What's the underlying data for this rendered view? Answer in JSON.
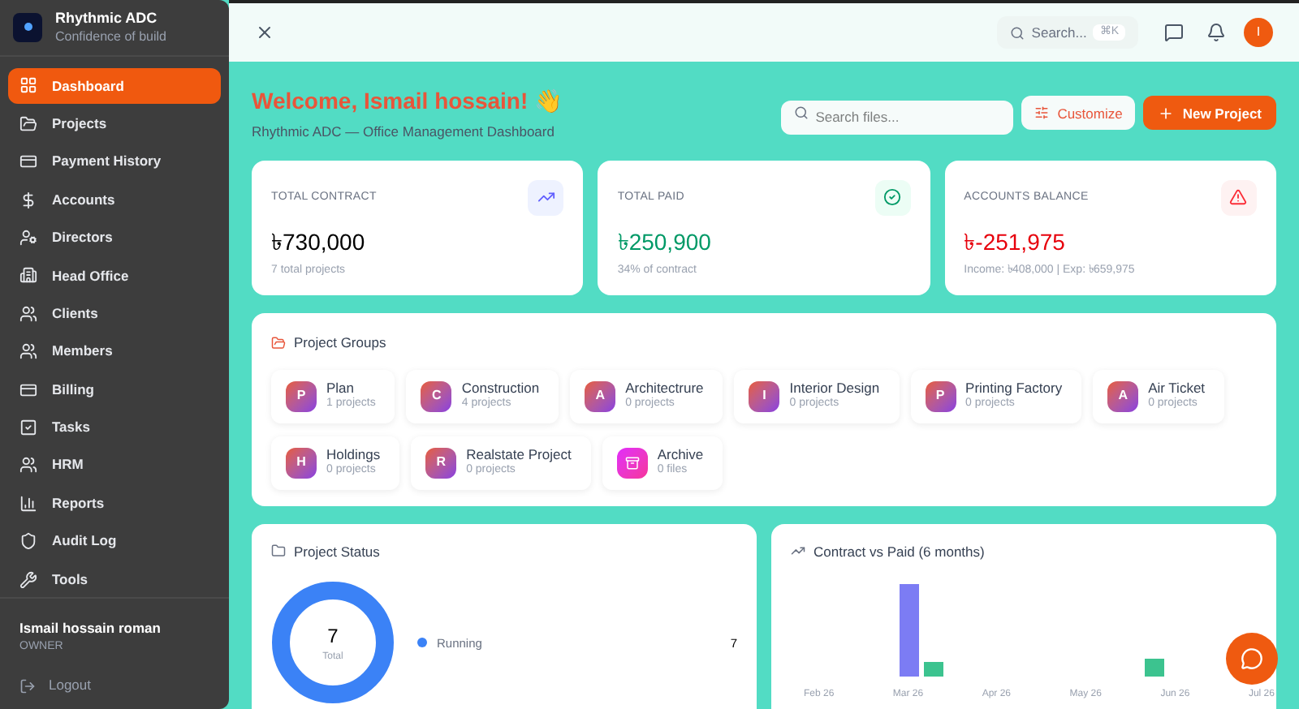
{
  "brand": {
    "name": "Rhythmic ADC",
    "tagline": "Confidence of build"
  },
  "nav": [
    {
      "label": "Dashboard",
      "selected": true
    },
    {
      "label": "Projects",
      "selected": false
    },
    {
      "label": "Payment History",
      "selected": false
    },
    {
      "label": "Accounts",
      "selected": false
    },
    {
      "label": "Directors",
      "selected": false
    },
    {
      "label": "Head Office",
      "selected": false
    },
    {
      "label": "Clients",
      "selected": false
    },
    {
      "label": "Members",
      "selected": false
    },
    {
      "label": "Billing",
      "selected": false
    },
    {
      "label": "Tasks",
      "selected": false
    },
    {
      "label": "HRM",
      "selected": false
    },
    {
      "label": "Reports",
      "selected": false
    },
    {
      "label": "Audit Log",
      "selected": false
    },
    {
      "label": "Tools",
      "selected": false
    }
  ],
  "user": {
    "name": "Ismail hossain roman",
    "role": "OWNER",
    "logout": "Logout"
  },
  "topbar": {
    "search_placeholder": "Search...",
    "shortcut": "⌘K",
    "avatar": "I"
  },
  "header": {
    "title": "Welcome, Ismail hossain! 👋",
    "subtitle": "Rhythmic ADC — Office Management Dashboard",
    "search_placeholder": "Search files...",
    "customize": "Customize",
    "new_project": "New Project"
  },
  "stats": [
    {
      "label": "TOTAL CONTRACT",
      "value": "৳730,000",
      "note": "7 total projects",
      "kind": "neutral"
    },
    {
      "label": "TOTAL PAID",
      "value": "৳250,900",
      "note": "34% of contract",
      "kind": "success"
    },
    {
      "label": "ACCOUNTS BALANCE",
      "value": "৳-251,975",
      "note": "Income: ৳408,000 | Exp: ৳659,975",
      "kind": "danger"
    }
  ],
  "groups": {
    "title": "Project Groups",
    "items": [
      {
        "letter": "P",
        "name": "Plan",
        "count": "1 projects",
        "kind": "group"
      },
      {
        "letter": "C",
        "name": "Construction",
        "count": "4 projects",
        "kind": "group"
      },
      {
        "letter": "A",
        "name": "Architectrure",
        "count": "0 projects",
        "kind": "group"
      },
      {
        "letter": "I",
        "name": "Interior Design",
        "count": "0 projects",
        "kind": "group"
      },
      {
        "letter": "P",
        "name": "Printing Factory",
        "count": "0 projects",
        "kind": "group"
      },
      {
        "letter": "A",
        "name": "Air Ticket",
        "count": "0 projects",
        "kind": "group"
      },
      {
        "letter": "H",
        "name": "Holdings",
        "count": "0 projects",
        "kind": "group"
      },
      {
        "letter": "R",
        "name": "Realstate Project",
        "count": "0 projects",
        "kind": "group"
      },
      {
        "name": "Archive",
        "count": "0 files",
        "kind": "archive"
      }
    ]
  },
  "status": {
    "title": "Project Status",
    "total": "7",
    "total_label": "Total",
    "legend": [
      {
        "label": "Running",
        "value": "7",
        "color": "#3b82f6"
      }
    ]
  },
  "contract_chart": {
    "title": "Contract vs Paid (6 months)",
    "months": [
      "Feb 26",
      "Mar 26",
      "Apr 26",
      "May 26",
      "Jun 26",
      "Jul 26"
    ]
  }
}
